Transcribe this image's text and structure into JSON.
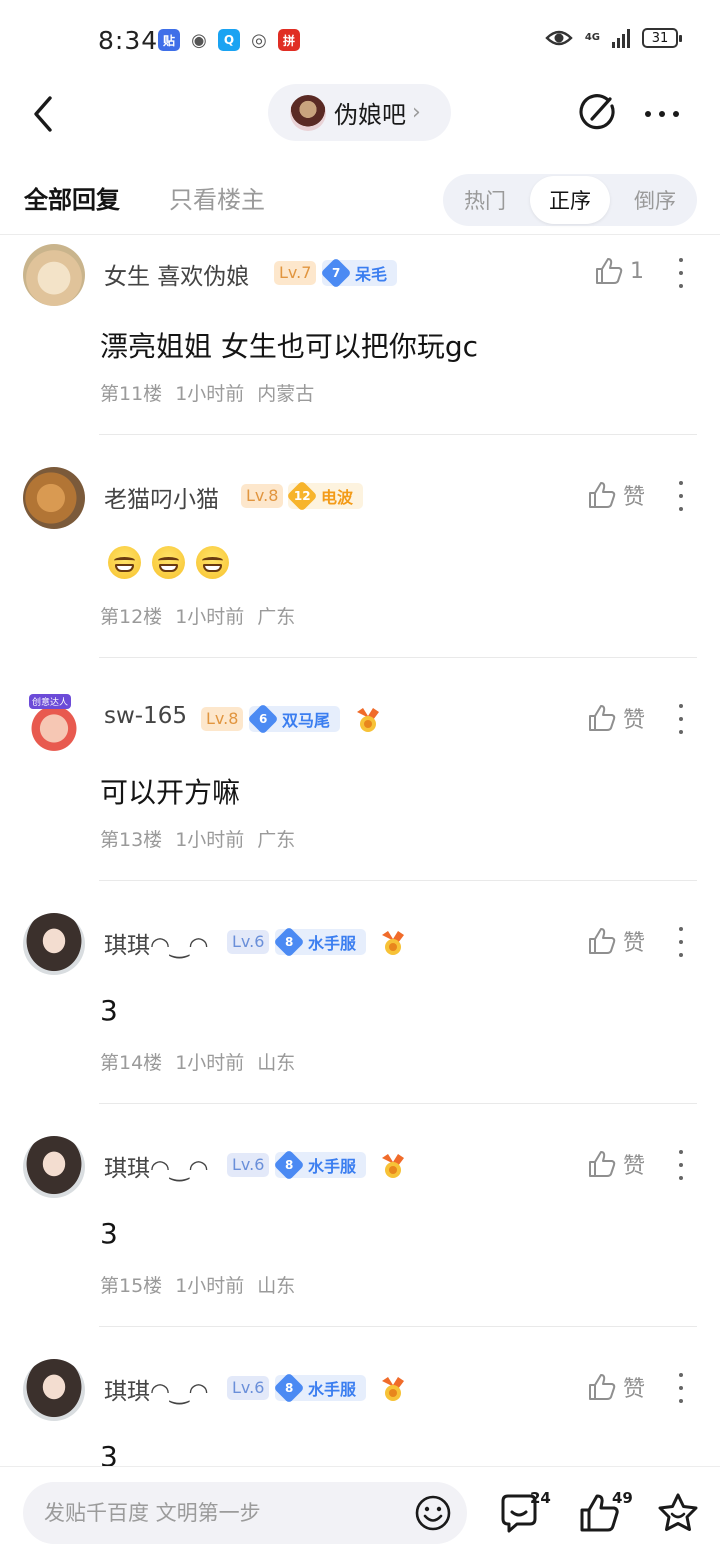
{
  "status_bar": {
    "time": "8:34",
    "apps": [
      {
        "icon": "tieba-app-icon",
        "glyph": "贴",
        "color": "#3f6fe8"
      },
      {
        "icon": "wechat-app-icon",
        "glyph": "◉",
        "color": "#555555"
      },
      {
        "icon": "qq-browser-app-icon",
        "glyph": "Q",
        "color": "#1aa3f2"
      },
      {
        "icon": "radar-app-icon",
        "glyph": "◎",
        "color": "#555555"
      },
      {
        "icon": "pinduoduo-app-icon",
        "glyph": "拼",
        "color": "#e02e24"
      }
    ],
    "network": "4G",
    "battery": "31"
  },
  "header": {
    "forum_name": "伪娘吧"
  },
  "filters": {
    "all_replies": "全部回复",
    "op_only": "只看楼主",
    "sort_options": [
      "热门",
      "正序",
      "倒序"
    ],
    "active_sort": "正序"
  },
  "posts": [
    {
      "username": "女生 喜欢伪娘",
      "level": "Lv.7",
      "badge_num": "7",
      "badge_name": "呆毛",
      "content": "漂亮姐姐 女生也可以把你玩gc",
      "floor": "第11楼",
      "time": "1小时前",
      "location": "内蒙古",
      "like_label": "1"
    },
    {
      "username": "老猫叼小猫",
      "level": "Lv.8",
      "badge_num": "12",
      "badge_name": "电波",
      "floor": "第12楼",
      "time": "1小时前",
      "location": "广东",
      "like_label": "赞"
    },
    {
      "username": "sw-165",
      "level": "Lv.8",
      "badge_num": "6",
      "badge_name": "双马尾",
      "avatar_tag": "创意达人",
      "content": "可以开方嘛",
      "floor": "第13楼",
      "time": "1小时前",
      "location": "广东",
      "like_label": "赞"
    },
    {
      "username": "琪琪◠‿◠",
      "level": "Lv.6",
      "badge_num": "8",
      "badge_name": "水手服",
      "content": "3",
      "floor": "第14楼",
      "time": "1小时前",
      "location": "山东",
      "like_label": "赞"
    },
    {
      "username": "琪琪◠‿◠",
      "level": "Lv.6",
      "badge_num": "8",
      "badge_name": "水手服",
      "content": "3",
      "floor": "第15楼",
      "time": "1小时前",
      "location": "山东",
      "like_label": "赞"
    },
    {
      "username": "琪琪◠‿◠",
      "level": "Lv.6",
      "badge_num": "8",
      "badge_name": "水手服",
      "content": "3",
      "like_label": "赞"
    }
  ],
  "bottom_bar": {
    "reply_placeholder": "发贴千百度 文明第一步",
    "comment_count": "24",
    "like_count": "49"
  }
}
